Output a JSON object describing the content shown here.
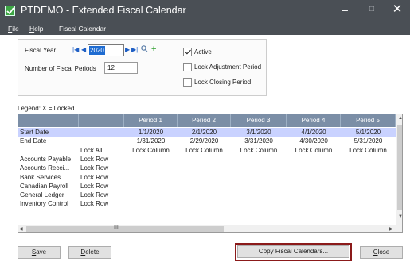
{
  "window": {
    "title": "PTDEMO - Extended Fiscal Calendar"
  },
  "menu": [
    "File",
    "Help",
    "Fiscal Calendar"
  ],
  "form": {
    "fiscal_year_label": "Fiscal Year",
    "fiscal_year_value": "2020",
    "periods_label": "Number of Fiscal Periods",
    "periods_value": "12",
    "active_label": "Active",
    "active_checked": true,
    "lock_adjustment_label": "Lock Adjustment Period",
    "lock_adjustment_checked": false,
    "lock_closing_label": "Lock Closing Period",
    "lock_closing_checked": false
  },
  "legend": "Legend: X = Locked",
  "grid": {
    "headers": [
      "",
      "",
      "Period 1",
      "Period 2",
      "Period 3",
      "Period 4",
      "Period 5"
    ],
    "rows": [
      [
        "Start Date",
        "",
        "1/1/2020",
        "2/1/2020",
        "3/1/2020",
        "4/1/2020",
        "5/1/2020"
      ],
      [
        "End Date",
        "",
        "1/31/2020",
        "2/29/2020",
        "3/31/2020",
        "4/30/2020",
        "5/31/2020"
      ],
      [
        "",
        "Lock All",
        "Lock Column",
        "Lock Column",
        "Lock Column",
        "Lock Column",
        "Lock Column"
      ],
      [
        "Accounts Payable",
        "Lock Row",
        "",
        "",
        "",
        "",
        ""
      ],
      [
        "Accounts Recei...",
        "Lock Row",
        "",
        "",
        "",
        "",
        ""
      ],
      [
        "Bank Services",
        "Lock Row",
        "",
        "",
        "",
        "",
        ""
      ],
      [
        "Canadian Payroll",
        "Lock Row",
        "",
        "",
        "",
        "",
        ""
      ],
      [
        "General Ledger",
        "Lock Row",
        "",
        "",
        "",
        "",
        ""
      ],
      [
        "Inventory Control",
        "Lock Row",
        "",
        "",
        "",
        "",
        ""
      ]
    ],
    "hscroll_label": "III"
  },
  "buttons": {
    "save": "Save",
    "delete": "Delete",
    "copy": "Copy Fiscal Calendars...",
    "close": "Close"
  },
  "colors": {
    "titlebar": "#4a4f55",
    "grid_header": "#7b8ea6",
    "selected_row": "#c9d2ff",
    "copy_highlight": "#8b1a1a"
  }
}
